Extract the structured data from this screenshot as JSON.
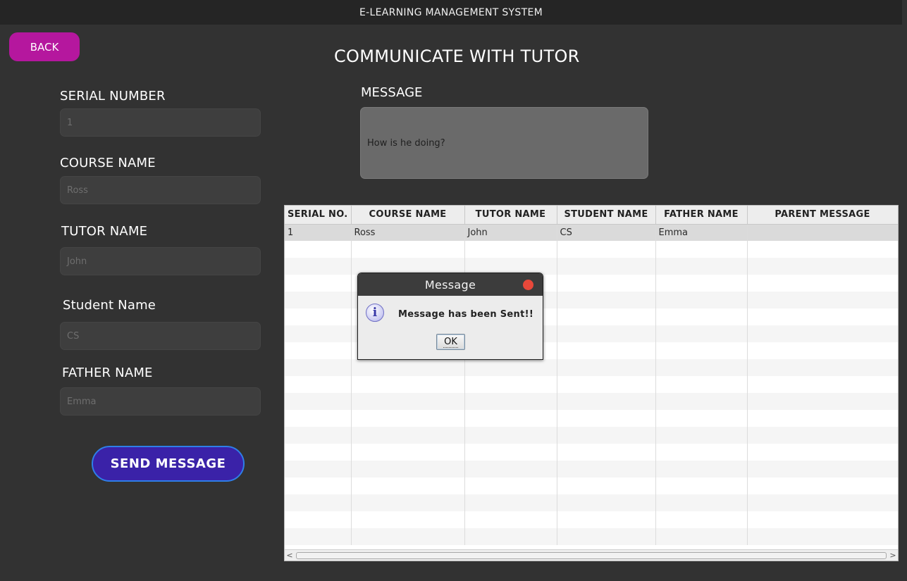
{
  "window": {
    "title": "E-LEARNING MANAGEMENT SYSTEM"
  },
  "header": {
    "back_label": "BACK",
    "page_title": "COMMUNICATE WITH TUTOR"
  },
  "form": {
    "serial_number": {
      "label": "SERIAL NUMBER",
      "value": "1"
    },
    "course_name": {
      "label": "COURSE NAME",
      "value": "Ross"
    },
    "tutor_name": {
      "label": "TUTOR NAME",
      "value": "John"
    },
    "student_name": {
      "label": "Student Name",
      "value": "CS"
    },
    "father_name": {
      "label": "FATHER NAME",
      "value": "Emma"
    },
    "send_label": "SEND MESSAGE"
  },
  "message": {
    "label": "MESSAGE",
    "value": "How is he doing?"
  },
  "table": {
    "columns": [
      "SERIAL NO.",
      "COURSE NAME",
      "TUTOR NAME",
      "STUDENT NAME",
      "FATHER NAME",
      "PARENT MESSAGE"
    ],
    "rows": [
      [
        "1",
        "Ross",
        "John",
        "CS",
        "Emma",
        ""
      ]
    ]
  },
  "dialog": {
    "title": "Message",
    "icon": "info-icon",
    "text": "Message has been Sent!!",
    "ok_label": "OK"
  },
  "colors": {
    "background": "#323232",
    "back_button": "#b5179e",
    "send_button": "#3a22a8",
    "send_button_border": "#2e7fe8",
    "dialog_close": "#e8483a"
  }
}
